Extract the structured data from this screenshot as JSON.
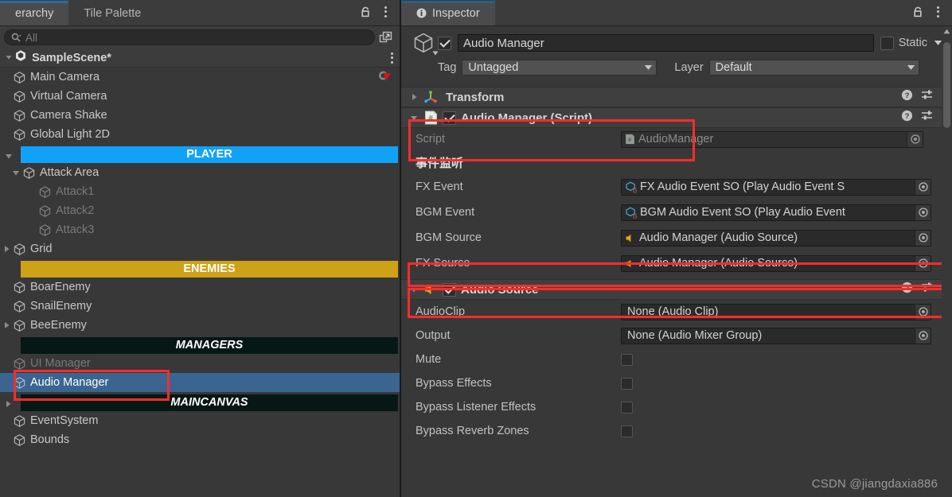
{
  "hierarchy": {
    "tabs": [
      {
        "label": "erarchy",
        "active": true
      },
      {
        "label": "Tile Palette",
        "active": false
      }
    ],
    "search": {
      "value": "",
      "placeholder": "All"
    },
    "scene": {
      "name": "SampleScene*"
    },
    "items": [
      {
        "label": "Main Camera",
        "indent": 1,
        "arrow": "none",
        "style": "normal",
        "flag": true
      },
      {
        "label": "Virtual Camera",
        "indent": 1,
        "arrow": "none",
        "style": "normal",
        "flag": false
      },
      {
        "label": "Camera Shake",
        "indent": 1,
        "arrow": "none",
        "style": "normal",
        "flag": false
      },
      {
        "label": "Global Light 2D",
        "indent": 1,
        "arrow": "none",
        "style": "normal",
        "flag": false
      },
      {
        "label": "PLAYER",
        "indent": 1,
        "arrow": "expanded",
        "style": "banner-player",
        "flag": false
      },
      {
        "label": "Attack Area",
        "indent": 2,
        "arrow": "expanded",
        "style": "normal",
        "flag": false
      },
      {
        "label": "Attack1",
        "indent": 3,
        "arrow": "none",
        "style": "dim",
        "flag": false
      },
      {
        "label": "Attack2",
        "indent": 3,
        "arrow": "none",
        "style": "dim",
        "flag": false
      },
      {
        "label": "Attack3",
        "indent": 3,
        "arrow": "none",
        "style": "dim",
        "flag": false
      },
      {
        "label": "Grid",
        "indent": 1,
        "arrow": "collapsed",
        "style": "normal",
        "flag": false
      },
      {
        "label": "ENEMIES",
        "indent": 1,
        "arrow": "none",
        "style": "banner-enemies",
        "flag": false
      },
      {
        "label": "BoarEnemy",
        "indent": 1,
        "arrow": "none",
        "style": "normal",
        "flag": false
      },
      {
        "label": "SnailEnemy",
        "indent": 1,
        "arrow": "none",
        "style": "normal",
        "flag": false
      },
      {
        "label": "BeeEnemy",
        "indent": 1,
        "arrow": "collapsed",
        "style": "normal",
        "flag": false
      },
      {
        "label": "MANAGERS",
        "indent": 1,
        "arrow": "none",
        "style": "banner-dark",
        "flag": false
      },
      {
        "label": "UI Manager",
        "indent": 1,
        "arrow": "none",
        "style": "dim",
        "flag": false
      },
      {
        "label": "Audio Manager",
        "indent": 1,
        "arrow": "none",
        "style": "selected",
        "flag": false
      },
      {
        "label": "MAINCANVAS",
        "indent": 1,
        "arrow": "collapsed",
        "style": "banner-dark",
        "flag": false
      },
      {
        "label": "EventSystem",
        "indent": 1,
        "arrow": "none",
        "style": "normal",
        "flag": false
      },
      {
        "label": "Bounds",
        "indent": 1,
        "arrow": "none",
        "style": "normal",
        "flag": false
      }
    ]
  },
  "inspector": {
    "tab": {
      "label": "Inspector"
    },
    "gameobject": {
      "enabled": true,
      "name": "Audio Manager",
      "static_checked": false,
      "static_label": "Static",
      "tag_label": "Tag",
      "tag_value": "Untagged",
      "layer_label": "Layer",
      "layer_value": "Default"
    },
    "components": [
      {
        "title": "Transform",
        "icon": "transform-icon",
        "folded": true,
        "has_enable": false
      },
      {
        "title": "Audio Manager (Script)",
        "icon": "script-icon",
        "folded": false,
        "has_enable": true,
        "enabled": true
      },
      {
        "title": "Audio Source",
        "icon": "audio-source-icon",
        "folded": false,
        "has_enable": true,
        "enabled": true
      }
    ],
    "script_row": {
      "label": "Script",
      "value": "AudioManager"
    },
    "section_event": {
      "title": "事件监听"
    },
    "script_props": [
      {
        "label": "FX Event",
        "value": "FX Audio Event SO (Play Audio Event S",
        "icon": "scriptable-object-icon",
        "highlight": false
      },
      {
        "label": "BGM Event",
        "value": "BGM Audio Event SO (Play Audio Event",
        "icon": "scriptable-object-icon",
        "highlight": false
      },
      {
        "label": "BGM Source",
        "value": "Audio Manager (Audio Source)",
        "icon": "audio-source-icon",
        "highlight": true
      },
      {
        "label": "FX Source",
        "value": "Audio Manager (Audio Source)",
        "icon": "audio-source-icon",
        "highlight": true
      }
    ],
    "audiosource_props": [
      {
        "label": "AudioClip",
        "type": "object",
        "value": "None (Audio Clip)"
      },
      {
        "label": "Output",
        "type": "object",
        "value": "None (Audio Mixer Group)"
      },
      {
        "label": "Mute",
        "type": "bool",
        "value": false
      },
      {
        "label": "Bypass Effects",
        "type": "bool",
        "value": false
      },
      {
        "label": "Bypass Listener Effects",
        "type": "bool",
        "value": false
      },
      {
        "label": "Bypass Reverb Zones",
        "type": "bool",
        "value": false
      }
    ]
  },
  "watermark": {
    "text": "CSDN @jiangdaxia886"
  },
  "colors": {
    "accent_blue": "#11a2f8",
    "selection_blue": "#3a6591",
    "banner_yellow": "#cfa117",
    "annotation_red": "#fb2c2c",
    "panel_bg": "#383838"
  }
}
